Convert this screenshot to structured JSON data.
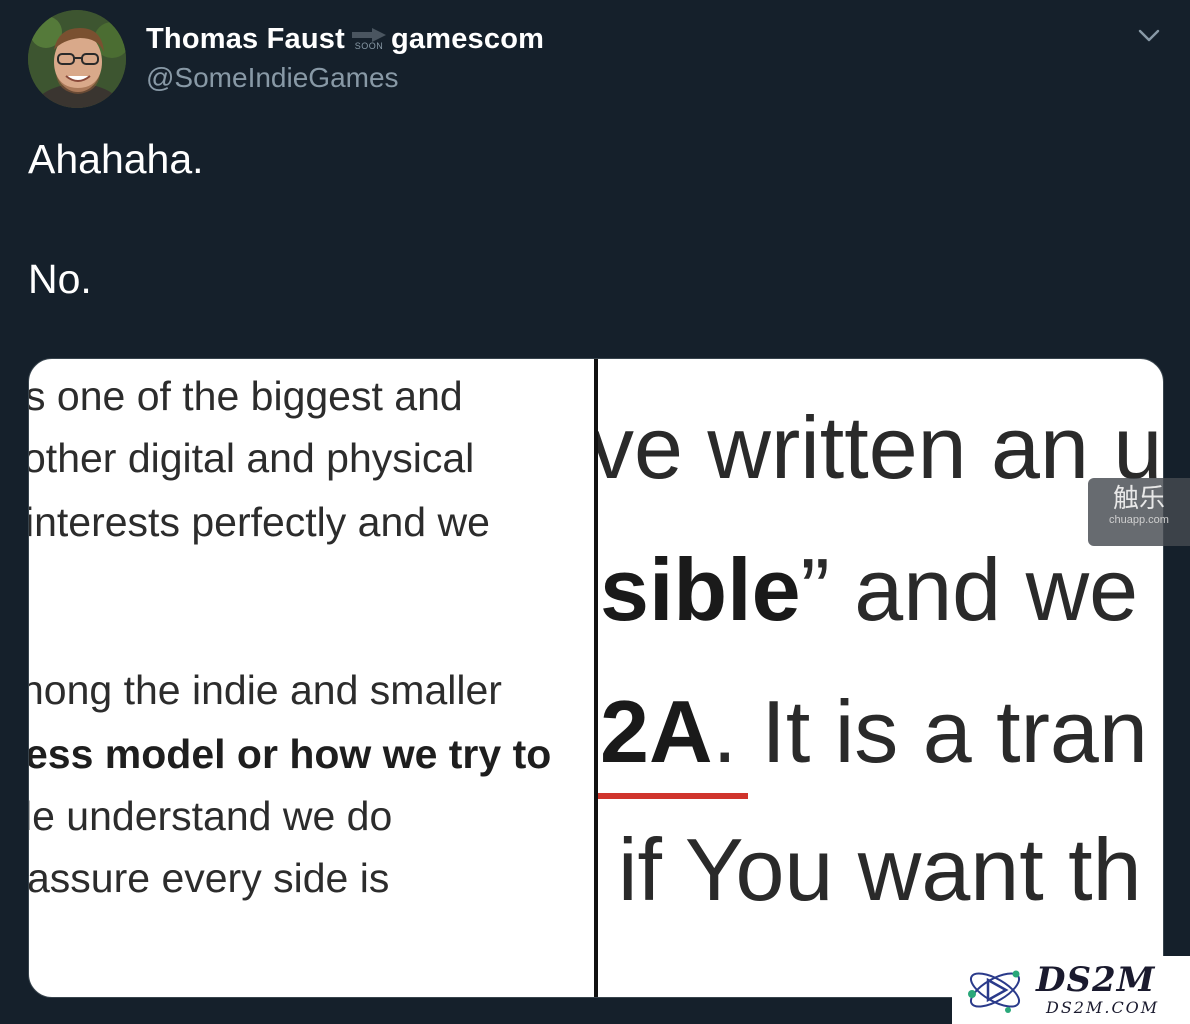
{
  "user": {
    "name_part1": "Thomas Faust",
    "badge_text": "SOON",
    "name_part2": "gamescom",
    "handle": "@SomeIndieGames"
  },
  "tweet": {
    "line1": "Ahahaha.",
    "line2": "No."
  },
  "image_left_lines": [
    "s one of the biggest and",
    "other digital and physical",
    " interests perfectly and we",
    "nong the indie and smaller",
    "ess model or how we try to",
    "le understand we do",
    " assure every side is"
  ],
  "image_right": {
    "line1": "ve written an u",
    "line2_bold": "sible",
    "line2_rest": "” and we",
    "line3_bold": "2A",
    "line3_rest": ". It is a tran",
    "line4": "if You want th"
  },
  "watermarks": {
    "chuapp_cn": "触乐",
    "chuapp_domain": "chuapp.com",
    "ds2m_big": "DS2M",
    "ds2m_small": "DS2M.COM"
  },
  "colors": {
    "background": "#15202b",
    "secondary_text": "#8899a6",
    "underline_accent": "#d0342c"
  },
  "icons": [
    "avatar",
    "arrow-right-icon",
    "chevron-down-icon",
    "atom-logo-icon"
  ]
}
